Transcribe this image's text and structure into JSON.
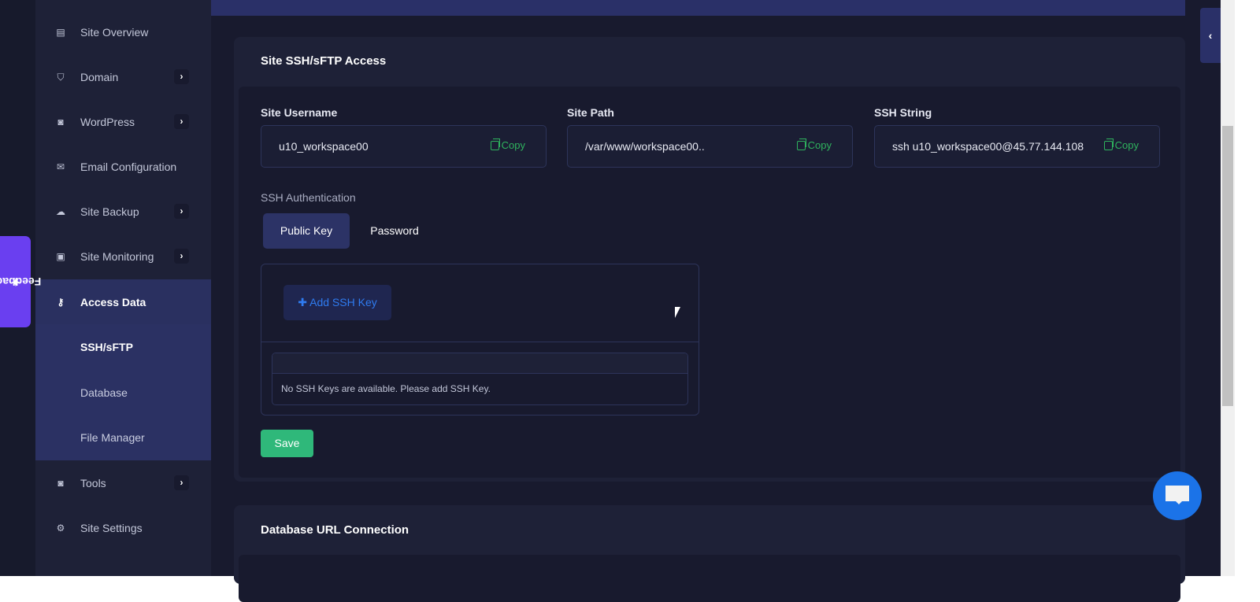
{
  "sidebar": {
    "items": [
      {
        "label": "Site Overview",
        "icon": "site-overview-icon",
        "has_chevron": false
      },
      {
        "label": "Domain",
        "icon": "shield-icon",
        "has_chevron": true
      },
      {
        "label": "WordPress",
        "icon": "wordpress-icon",
        "has_chevron": true
      },
      {
        "label": "Email Configuration",
        "icon": "mail-icon",
        "has_chevron": false
      },
      {
        "label": "Site Backup",
        "icon": "backup-icon",
        "has_chevron": true
      },
      {
        "label": "Site Monitoring",
        "icon": "monitor-icon",
        "has_chevron": true
      },
      {
        "label": "Access Data",
        "icon": "key-icon",
        "has_chevron": false
      },
      {
        "label": "Tools",
        "icon": "tools-icon",
        "has_chevron": true
      },
      {
        "label": "Site Settings",
        "icon": "gear-icon",
        "has_chevron": false
      }
    ],
    "sub_items": [
      {
        "label": "SSH/sFTP"
      },
      {
        "label": "Database"
      },
      {
        "label": "File Manager"
      }
    ]
  },
  "feedback": {
    "label": "Feedback"
  },
  "ssh_card": {
    "title": "Site SSH/sFTP Access",
    "fields": [
      {
        "label": "Site Username",
        "value": "u10_workspace00",
        "copy_label": "Copy"
      },
      {
        "label": "Site Path",
        "value": "/var/www/workspace00..",
        "copy_label": "Copy"
      },
      {
        "label": "SSH String",
        "value": "ssh u10_workspace00@45.77.144.108",
        "copy_label": "Copy"
      }
    ],
    "auth_label": "SSH Authentication",
    "tabs": [
      {
        "label": "Public Key",
        "active": true
      },
      {
        "label": "Password",
        "active": false
      }
    ],
    "add_key_label": "Add SSH Key",
    "empty_message": "No SSH Keys are available. Please add SSH Key.",
    "save_label": "Save"
  },
  "db_card": {
    "title": "Database URL Connection"
  },
  "colors": {
    "accent": "#2a3068",
    "copy": "#2fb35e",
    "save": "#2fb87a",
    "add": "#2f7bf0",
    "feedback": "#6a3ff0",
    "chat": "#1b73e8"
  }
}
